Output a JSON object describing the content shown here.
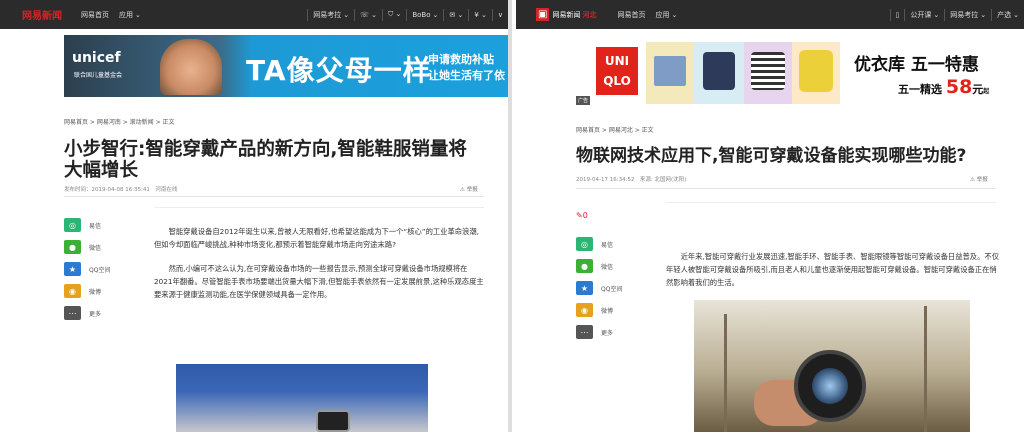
{
  "left": {
    "topbar": {
      "logo": "网易新闻",
      "links": [
        "网易首页",
        "应用"
      ],
      "right": [
        "网易考拉",
        "BoBo"
      ]
    },
    "banner": {
      "brand": "unicef",
      "brand_sub": "联合国儿童基金会",
      "headline": "TA像父母一样",
      "line1": "申请救助补贴",
      "line2": "让她生活有了依"
    },
    "breadcrumb": "网易首页 > 网易河南 > 滚动新闻 > 正文",
    "title": "小步智行:智能穿戴产品的新方向,智能鞋服销量将大幅增长",
    "meta": "发布时间：2019-04-08 16:35:41　河南在线",
    "report": "举报",
    "share": [
      "易信",
      "微信",
      "QQ空间",
      "微博",
      "更多"
    ],
    "paragraphs": [
      "智能穿戴设备自2012年诞生以来,曾被人无限看好,也希望这能成为下一个“核心”的工业革命浪潮,但如今却面临严峻挑战,种种市场变化,都预示着智能穿戴市场走向穷途末路?",
      "然而,小编可不这么认为,在可穿戴设备市场的一些报告显示,预测全球可穿戴设备市场规模将在2021年翻番。尽管智能手表市场要端出货量大幅下滑,但智能手表依然有一定发展前景,这种乐观态度主要来源于健康监测功能,在医学保健领域具备一定作用。"
    ]
  },
  "right": {
    "topbar": {
      "logo": "网易新闻",
      "region": "河北",
      "links": [
        "网易首页",
        "应用"
      ],
      "right": [
        "公开课",
        "网易考拉",
        "产选"
      ]
    },
    "banner": {
      "brand_top": "UNI",
      "brand_bottom": "QLO",
      "headline": "优衣库 五一特惠",
      "subline": "五一精选",
      "price": "58",
      "unit": "元",
      "unit_suffix": "起",
      "ad_label": "广告"
    },
    "breadcrumb": "网易首页 > 网易河北 > 正文",
    "title": "物联网技术应用下,智能可穿戴设备能实现哪些功能?",
    "meta": "2019-04-17 16:34:52　来源: 北国网(沈阳)",
    "report": "举报",
    "comment_count": "0",
    "share": [
      "易信",
      "微信",
      "QQ空间",
      "微博",
      "更多"
    ],
    "paragraphs": [
      "近年来,智能可穿戴行业发展迅速,智能手环、智能手表、智能眼镜等智能可穿戴设备日益普及。不仅年轻人被智能可穿戴设备所吸引,而且老人和儿童也逐渐使用起智能可穿戴设备。智能可穿戴设备正在悄然影响着我们的生活。"
    ]
  },
  "colors": {
    "topbar": "#2b2b2b",
    "brand_red": "#d6232a",
    "yixin": "#2bb673",
    "wechat": "#3cb035",
    "qzone": "#2b7bd0",
    "weibo": "#e6a21c",
    "more": "#555555"
  }
}
